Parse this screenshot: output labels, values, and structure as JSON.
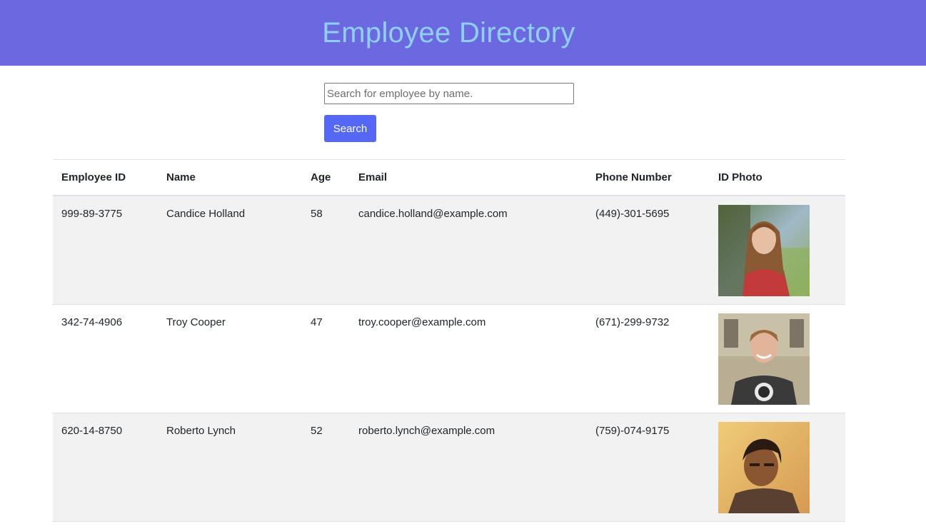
{
  "header": {
    "title": "Employee Directory"
  },
  "search": {
    "placeholder": "Search for employee by name.",
    "value": "",
    "button_label": "Search"
  },
  "table": {
    "columns": [
      "Employee ID",
      "Name",
      "Age",
      "Email",
      "Phone Number",
      "ID Photo"
    ],
    "rows": [
      {
        "id": "999-89-3775",
        "name": "Candice Holland",
        "age": "58",
        "email": "candice.holland@example.com",
        "phone": "(449)-301-5695"
      },
      {
        "id": "342-74-4906",
        "name": "Troy Cooper",
        "age": "47",
        "email": "troy.cooper@example.com",
        "phone": "(671)-299-9732"
      },
      {
        "id": "620-14-8750",
        "name": "Roberto Lynch",
        "age": "52",
        "email": "roberto.lynch@example.com",
        "phone": "(759)-074-9175"
      }
    ]
  },
  "colors": {
    "header_bg": "#6b68e0",
    "title_color": "#8fd0f7",
    "button_bg": "#5468f5",
    "stripe_bg": "#f2f2f2"
  }
}
